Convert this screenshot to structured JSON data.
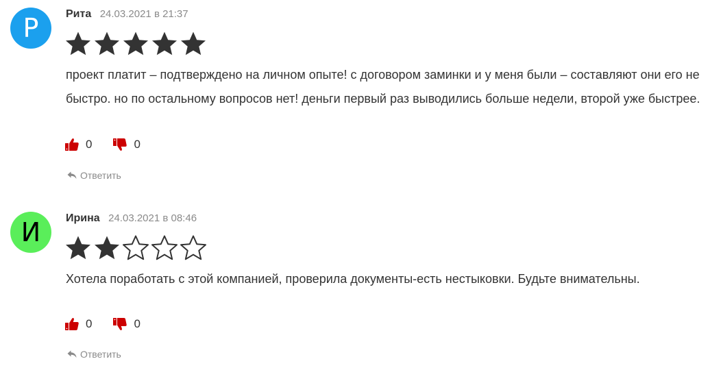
{
  "colors": {
    "star_filled": "#333333",
    "star_empty_stroke": "#333333",
    "vote_icon": "#cc0000",
    "meta_gray": "#8a8a8a"
  },
  "comments": [
    {
      "author": "Рита",
      "date": "24.03.2021 в 21:37",
      "avatar_letter": "Р",
      "avatar_bg": "#1ba0ee",
      "avatar_fg": "#ffffff",
      "rating": 5,
      "max_rating": 5,
      "text": "проект платит – подтверждено на личном опыте! с договором заминки и у меня были – составляют они его не быстро. но по остальному вопросов нет! деньги первый раз выводились больше недели, второй уже быстрее.",
      "likes": "0",
      "dislikes": "0",
      "reply_label": "Ответить",
      "like_icon": "thumbs-up-icon",
      "dislike_icon": "thumbs-down-icon",
      "reply_icon": "reply-arrow-icon"
    },
    {
      "author": "Ирина",
      "date": "24.03.2021 в 08:46",
      "avatar_letter": "И",
      "avatar_bg": "#5aee5a",
      "avatar_fg": "#000000",
      "rating": 2,
      "max_rating": 5,
      "text": "Хотела поработать с этой компанией, проверила документы-есть нестыковки. Будьте внимательны.",
      "likes": "0",
      "dislikes": "0",
      "reply_label": "Ответить",
      "like_icon": "thumbs-up-icon",
      "dislike_icon": "thumbs-down-icon",
      "reply_icon": "reply-arrow-icon"
    }
  ]
}
